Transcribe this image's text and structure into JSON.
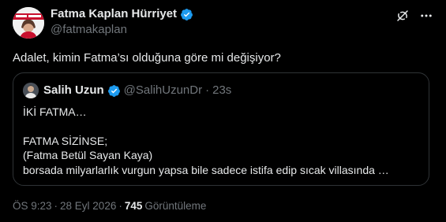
{
  "author": {
    "name": "Fatma Kaplan Hürriyet",
    "handle": "@fatmakaplan",
    "avatar_icon": "profile-photo-with-red-banner"
  },
  "tweet": {
    "text": "Adalet, kimin Fatma’sı olduğuna göre mi değişiyor?"
  },
  "quoted": {
    "name": "Salih Uzun",
    "handle": "@SalihUzunDr",
    "separator": "·",
    "time": "23s",
    "lines": [
      "İKİ FATMA…",
      "",
      "FATMA SİZİNSE;",
      "(Fatma Betül Sayan Kaya)",
      "borsada milyarlarlık vurgun yapsa bile sadece istifa edip sıcak villasında …"
    ]
  },
  "meta": {
    "time": "ÖS 9:23",
    "separator": "·",
    "date": "28 Eyl 2026",
    "separator2": "·",
    "views": "745",
    "views_label": "Görüntüleme"
  },
  "icons": {
    "verified": "verified-badge-icon",
    "grok": "grok-icon",
    "more": "more-icon"
  },
  "colors": {
    "background": "#000000",
    "text": "#e7e9ea",
    "secondary": "#71767b",
    "verified": "#1d9bf0",
    "border": "#2f3336"
  }
}
